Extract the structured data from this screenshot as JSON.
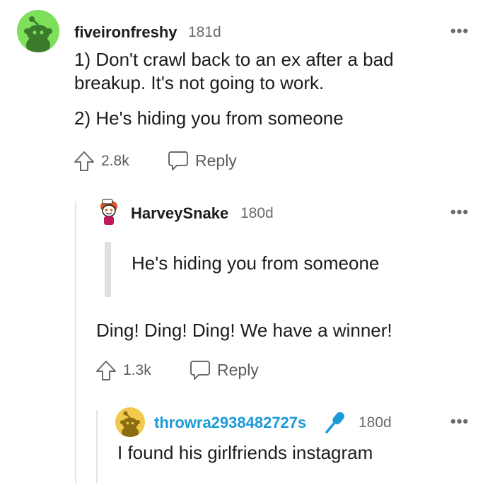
{
  "comments": [
    {
      "username": "fiveironfreshy",
      "time": "181d",
      "body_lines": [
        "1) Don't crawl back to an ex after a bad",
        "breakup. It's not going to work."
      ],
      "body_line2": "2) He's hiding you from someone",
      "votes": "2.8k",
      "reply_label": "Reply",
      "more": "•••"
    },
    {
      "username": "HarveySnake",
      "time": "180d",
      "quote": "He's hiding you from someone",
      "body": "Ding! Ding! Ding! We have a winner!",
      "votes": "1.3k",
      "reply_label": "Reply",
      "more": "•••"
    },
    {
      "username": "throwra2938482727s",
      "time": "180d",
      "body": "I found his girlfriends instagram",
      "username_color": "#1a9ad6",
      "more": "•••"
    }
  ],
  "colors": {
    "avatar_main": "#7ee05a",
    "avatar_throw": "#f2c94c",
    "op_username": "#1a9ad6"
  }
}
